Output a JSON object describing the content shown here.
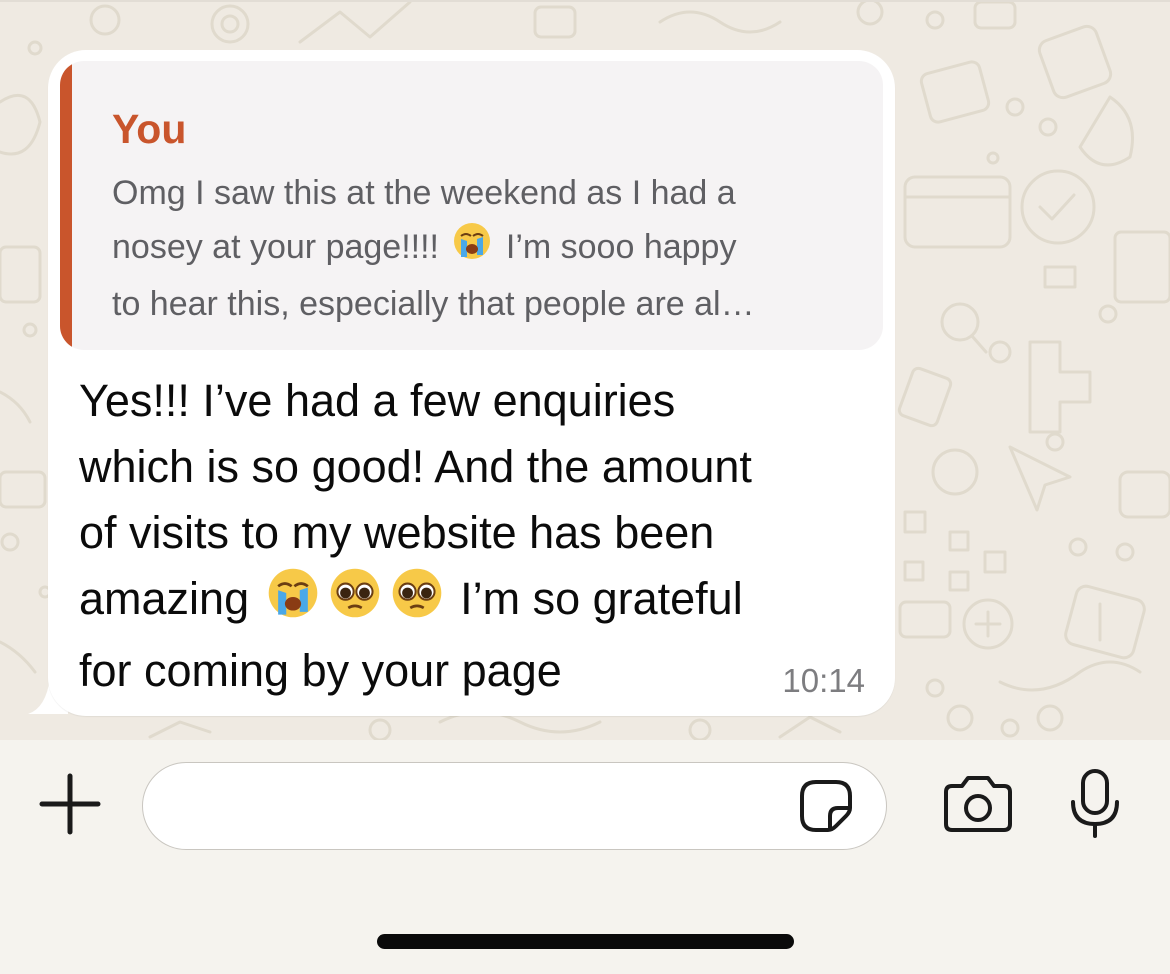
{
  "quoted_message": {
    "author": "You",
    "lines": [
      "Omg I saw this at the weekend as I had a",
      "nosey at your page!!!! ",
      " I’m sooo happy",
      "to hear this, especially that people are al…"
    ],
    "emoji": "loudly-crying-face"
  },
  "message": {
    "lines": [
      "Yes!!! I’ve had a few enquiries",
      "which is so good! And the amount",
      "of visits to my website has been",
      "amazing ",
      " I’m so grateful",
      "for coming by your page"
    ],
    "emojis": [
      "loudly-crying-face",
      "pleading-face",
      "pleading-face"
    ],
    "time": "10:14"
  },
  "composer": {
    "input_value": "",
    "icons": [
      "plus-icon",
      "sticker-icon",
      "camera-icon",
      "microphone-icon"
    ]
  },
  "colors": {
    "accent": "#c9552c",
    "bubble": "#ffffff",
    "chat_background": "#efeae2",
    "quote_background": "#f5f3f4"
  }
}
